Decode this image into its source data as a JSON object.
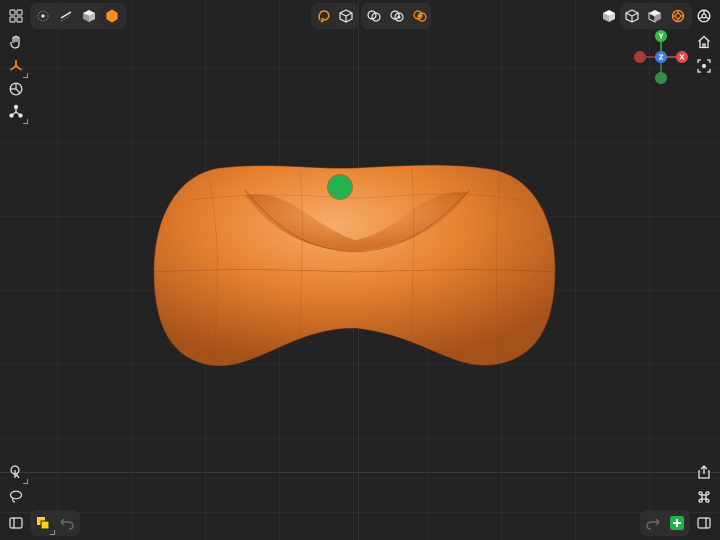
{
  "app": {
    "accent_color": "#ff8c1a",
    "add_color": "#22b14c"
  },
  "gizmo": {
    "y_label": "Y",
    "z_label": "Z",
    "x_label": "X",
    "y_color": "#3ab54a",
    "z_color": "#3d7be8",
    "x_color": "#e04848",
    "neg_y_color": "#3a8a4a",
    "neg_x_color": "#a83a3a"
  },
  "model": {
    "surface_color": "#e8822f",
    "shape": "peanut-shaped subdivision surface"
  },
  "pin": {
    "color": "#22b14c"
  },
  "toolbar_top_left": [
    "grid-view-icon",
    "vertex-mode-icon",
    "edge-mode-icon",
    "face-mode-icon",
    "object-mode-icon"
  ],
  "toolbar_top_center": [
    "smooth-orbit-icon",
    "box-display-icon",
    "boolean-union-icon",
    "boolean-subtract-icon",
    "boolean-intersect-icon"
  ],
  "toolbar_top_right": [
    "solid-shading-icon",
    "wireframe-shading-icon",
    "material-shading-icon",
    "render-shading-icon",
    "settings-icon"
  ],
  "toolbar_left": [
    "hand-tool-icon",
    "transform-tool-icon",
    "snap-icon",
    "pivot-icon"
  ],
  "toolbar_right": [
    "home-view-icon",
    "frame-selection-icon"
  ],
  "toolbar_bottom_left": [
    "tap-select-icon",
    "lasso-select-icon",
    "sidebar-toggle-icon",
    "color-swatch-icon",
    "undo-icon"
  ],
  "toolbar_bottom_right": [
    "share-icon",
    "command-icon",
    "redo-icon",
    "add-object-icon",
    "right-panel-icon"
  ]
}
